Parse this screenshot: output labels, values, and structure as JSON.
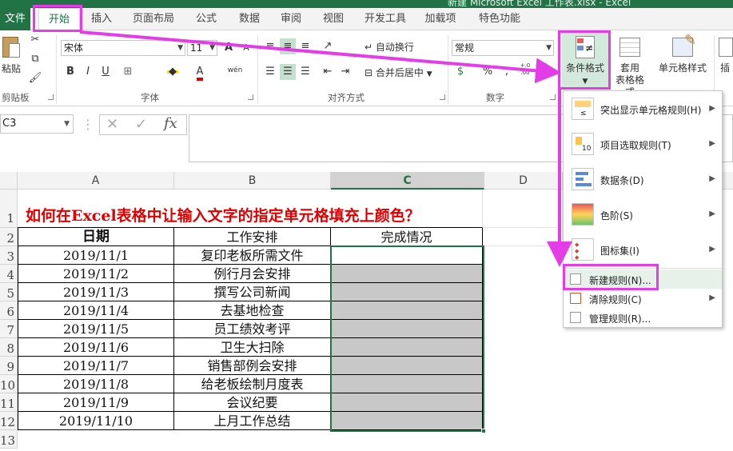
{
  "window": {
    "title": "新建 Microsoft Excel 工作表.xlsx - Excel"
  },
  "tabs": [
    "文件",
    "开始",
    "插入",
    "页面布局",
    "公式",
    "数据",
    "审阅",
    "视图",
    "开发工具",
    "加载项",
    "特色功能"
  ],
  "ribbon": {
    "clipboard": {
      "paste": "粘贴",
      "group": "剪贴板"
    },
    "font": {
      "name": "宋体",
      "size": "11",
      "grow": "A",
      "shrink": "A",
      "bold": "B",
      "italic": "I",
      "underline": "U",
      "phonetic": "wén",
      "font_color_letter": "A",
      "group": "字体"
    },
    "alignment": {
      "wrap": "自动换行",
      "merge": "合并后居中",
      "group": "对齐方式"
    },
    "number": {
      "format": "常规",
      "percent": "%",
      "comma": ",",
      "increase_decimal": "+.0 .00",
      "decrease_decimal": ".00 →.0",
      "group": "数字"
    },
    "styles": {
      "conditional_format": "条件格式",
      "table_format_1": "套用",
      "table_format_2": "表格格式",
      "cell_styles": "单元格样式",
      "insert": "插"
    }
  },
  "formula_bar": {
    "name_box": "C3",
    "fx": "fx",
    "cancel": "✕",
    "enter": "✓"
  },
  "sheet": {
    "columns": [
      "A",
      "B",
      "C",
      "D"
    ],
    "row_numbers": [
      "1",
      "2",
      "3",
      "4",
      "5",
      "6",
      "7",
      "8",
      "9",
      "10",
      "11",
      "12",
      "13"
    ],
    "title": "如何在Excel表格中让输入文字的指定单元格填充上颜色？",
    "headers": [
      "日期",
      "工作安排",
      "完成情况"
    ],
    "rows": [
      [
        "2019/11/1",
        "复印老板所需文件"
      ],
      [
        "2019/11/2",
        "例行月会安排"
      ],
      [
        "2019/11/3",
        "撰写公司新闻"
      ],
      [
        "2019/11/4",
        "去基地检查"
      ],
      [
        "2019/11/5",
        "员工绩效考评"
      ],
      [
        "2019/11/6",
        "卫生大扫除"
      ],
      [
        "2019/11/7",
        "销售部例会安排"
      ],
      [
        "2019/11/8",
        "给老板绘制月度表"
      ],
      [
        "2019/11/9",
        "会议纪要"
      ],
      [
        "2019/11/10",
        "上月工作总结"
      ]
    ]
  },
  "menu": {
    "items": [
      {
        "label": "突出显示单元格规则(H)",
        "icon": "highlight-rules-icon",
        "submenu": true
      },
      {
        "label": "项目选取规则(T)",
        "icon": "top-bottom-rules-icon",
        "submenu": true
      },
      {
        "label": "数据条(D)",
        "icon": "data-bars-icon",
        "submenu": true
      },
      {
        "label": "色阶(S)",
        "icon": "color-scales-icon",
        "submenu": true
      },
      {
        "label": "图标集(I)",
        "icon": "icon-sets-icon",
        "submenu": true
      }
    ],
    "small_items": [
      {
        "label": "新建规则(N)...",
        "icon": "new-rule-icon",
        "submenu": false
      },
      {
        "label": "清除规则(C)",
        "icon": "clear-rules-icon",
        "submenu": true
      },
      {
        "label": "管理规则(R)...",
        "icon": "manage-rules-icon",
        "submenu": false
      }
    ]
  },
  "colors": {
    "excel_green": "#217346",
    "annotation": "#e23de6",
    "title_red": "#e00000",
    "fill_gray": "#c8c8c8"
  }
}
